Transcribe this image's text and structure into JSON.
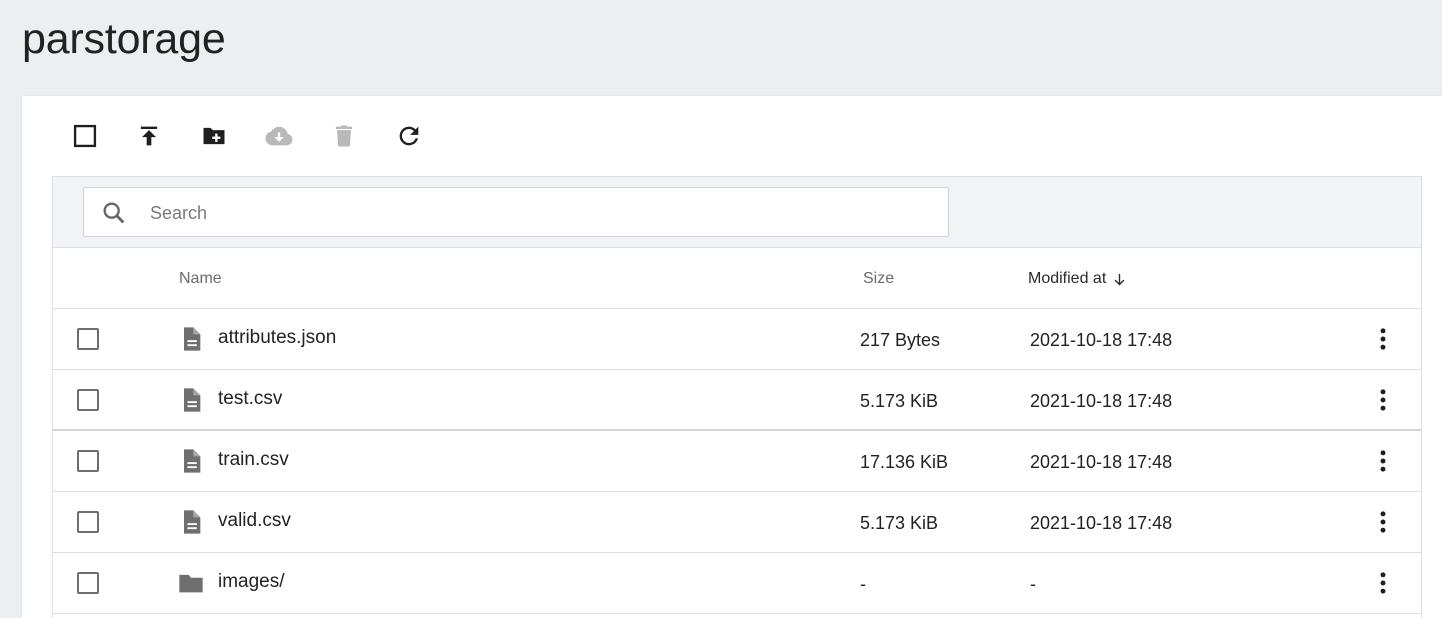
{
  "page": {
    "title": "parstorage"
  },
  "toolbar": {
    "buttons": [
      {
        "name": "select-all-checkbox-icon",
        "enabled": true
      },
      {
        "name": "upload-icon",
        "enabled": true
      },
      {
        "name": "create-folder-icon",
        "enabled": true
      },
      {
        "name": "download-cloud-icon",
        "enabled": false
      },
      {
        "name": "delete-icon",
        "enabled": false
      },
      {
        "name": "refresh-icon",
        "enabled": true
      }
    ]
  },
  "search": {
    "placeholder": "Search",
    "value": ""
  },
  "table": {
    "headers": {
      "name": "Name",
      "size": "Size",
      "modified": "Modified at"
    },
    "sort": {
      "column": "modified",
      "direction": "desc"
    },
    "rows": [
      {
        "icon": "file-document-icon",
        "name": "attributes.json",
        "size": "217 Bytes",
        "modified": "2021-10-18 17:48"
      },
      {
        "icon": "file-document-icon",
        "name": "test.csv",
        "size": "5.173 KiB",
        "modified": "2021-10-18 17:48"
      },
      {
        "icon": "file-document-icon",
        "name": "train.csv",
        "size": "17.136 KiB",
        "modified": "2021-10-18 17:48"
      },
      {
        "icon": "file-document-icon",
        "name": "valid.csv",
        "size": "5.173 KiB",
        "modified": "2021-10-18 17:48"
      },
      {
        "icon": "folder-icon",
        "name": "images/",
        "size": "-",
        "modified": "-"
      }
    ]
  },
  "colors": {
    "background": "#eceff2",
    "icon_active": "#1f1f1f",
    "icon_disabled": "#b9b9b9",
    "file_icon": "#6f6f6f"
  }
}
